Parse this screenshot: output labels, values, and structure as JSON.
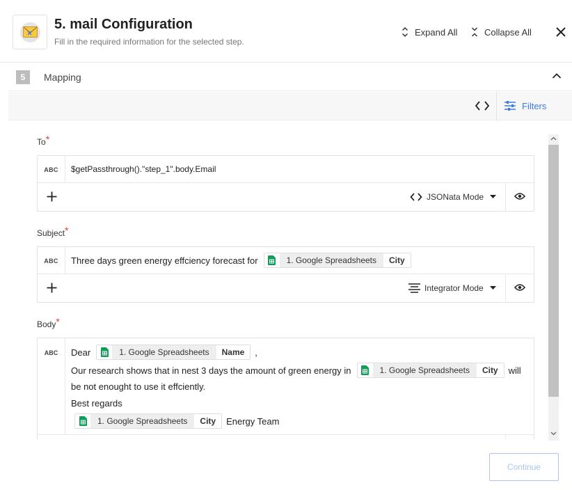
{
  "header": {
    "title": "5. mail Configuration",
    "subtitle": "Fill in the required information for the selected step.",
    "expand_label": "Expand All",
    "collapse_label": "Collapse All",
    "app_icon": "mail-envelope-icon"
  },
  "section": {
    "step_number": "5",
    "label": "Mapping"
  },
  "toolbar": {
    "filters_label": "Filters"
  },
  "fields": {
    "to": {
      "label": "To",
      "required_mark": "*",
      "type_badge": "ABC",
      "value": "$getPassthrough().\"step_1\".body.Email",
      "mode": "JSONata Mode"
    },
    "subject": {
      "label": "Subject",
      "required_mark": "*",
      "type_badge": "ABC",
      "text": "Three days green energy effciency forecast for",
      "pill": {
        "app": "1. Google Spreadsheets",
        "field": "City"
      },
      "mode": "Integrator Mode"
    },
    "body": {
      "label": "Body",
      "required_mark": "*",
      "type_badge": "ABC",
      "line1_text": "Dear",
      "line1_pill": {
        "app": "1. Google Spreadsheets",
        "field": "Name"
      },
      "line1_suffix": ",",
      "line2_text": "Our research shows that in nest 3 days the amount of green energy in",
      "line2_pill": {
        "app": "1. Google Spreadsheets",
        "field": "City"
      },
      "line2_suffix": "will",
      "line3_text": "be not enought to use it effciently.",
      "line4_text": "Best regards",
      "line5_pill": {
        "app": "1. Google Spreadsheets",
        "field": "City"
      },
      "line5_suffix": "Energy Team"
    }
  },
  "footer": {
    "continue_label": "Continue"
  },
  "colors": {
    "accent": "#3b7ddd",
    "required": "#e53935",
    "sheets_green": "#0f9d58",
    "continue_disabled": "#a9c5ef"
  }
}
